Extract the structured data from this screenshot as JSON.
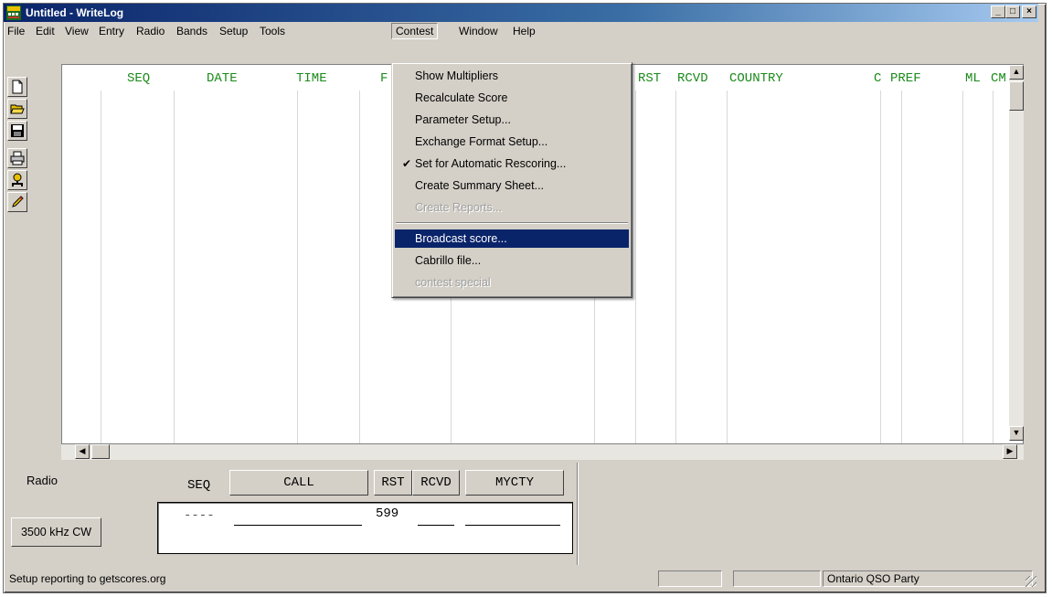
{
  "window": {
    "title": "Untitled - WriteLog"
  },
  "menu": [
    "File",
    "Edit",
    "View",
    "Entry",
    "Radio",
    "Bands",
    "Setup",
    "Tools",
    "Contest",
    "Window",
    "Help"
  ],
  "grid": {
    "columns": [
      "SEQ",
      "DATE",
      "TIME",
      "F",
      "RST",
      "RCVD",
      "COUNTRY",
      "C",
      "PREF",
      "ML",
      "CM"
    ]
  },
  "contest_menu": {
    "items": [
      {
        "label": "Show Multipliers",
        "state": "normal"
      },
      {
        "label": "Recalculate Score",
        "state": "normal"
      },
      {
        "label": "Parameter Setup...",
        "state": "normal"
      },
      {
        "label": "Exchange Format Setup...",
        "state": "normal"
      },
      {
        "label": "Set for Automatic Rescoring...",
        "state": "checked"
      },
      {
        "label": "Create Summary Sheet...",
        "state": "normal"
      },
      {
        "label": "Create Reports...",
        "state": "disabled"
      },
      {
        "label": "Broadcast score...",
        "state": "selected"
      },
      {
        "label": "Cabrillo file...",
        "state": "normal"
      },
      {
        "label": "contest special",
        "state": "disabled"
      }
    ],
    "check_glyph": "✔"
  },
  "entry": {
    "radio_label": "Radio",
    "seq_label": "SEQ",
    "fields": [
      "CALL",
      "RST",
      "RCVD",
      "MYCTY"
    ],
    "radio_button": "3500 kHz CW",
    "seq_value": "----",
    "rst_value": "599"
  },
  "status": {
    "message": "Setup reporting to getscores.org",
    "contest_name": "Ontario QSO Party"
  },
  "colors": {
    "title_start": "#0a246a",
    "column_header": "#1a8a1a",
    "menu_highlight": "#0a246a",
    "face": "#d4d0c8"
  },
  "icons": [
    "new-file-icon",
    "open-folder-icon",
    "save-disk-icon",
    "printer-icon",
    "operator-icon",
    "pencil-icon"
  ]
}
